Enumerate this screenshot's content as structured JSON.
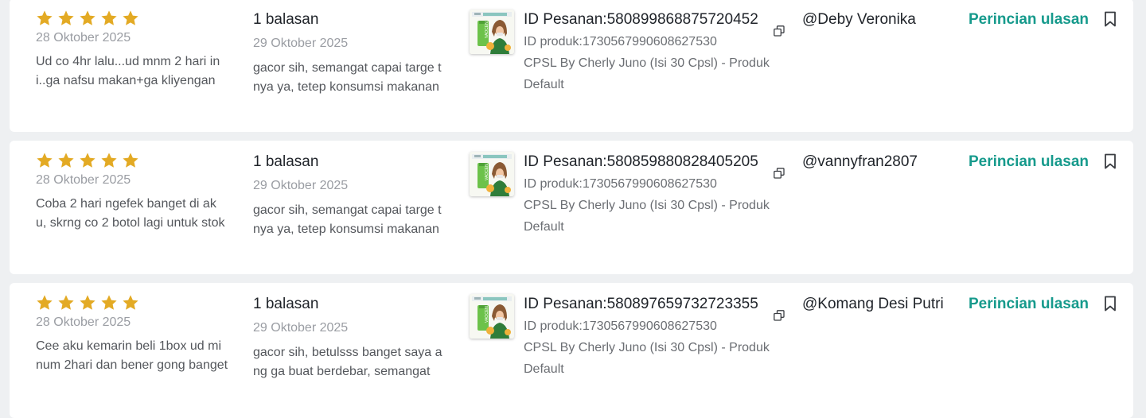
{
  "colors": {
    "star": "#e3aa24",
    "link": "#169a8c",
    "muted": "#9a9da3"
  },
  "icons": {
    "rating": "star-icon",
    "copy": "copy-icon",
    "save": "bookmark-icon"
  },
  "reviews": [
    {
      "rating": 5,
      "date": "28 Oktober 2025",
      "text": "Ud co 4hr lalu...ud mnm 2 hari in i..ga nafsu makan+ga kliyengan",
      "reply_count": "1 balasan",
      "reply_date": "29 Oktober 2025",
      "reply_text": "gacor sih, semangat capai targe tnya ya, tetep konsumsi makanan",
      "order_id": "ID Pesanan:580899868875720452",
      "product_id": "ID produk:1730567990608627530",
      "product_name": "CPSL By Cherly Juno (Isi 30 Cpsl) - Produk",
      "variant": "Default",
      "username": "@Deby Veronika",
      "detail_label": "Perincian ulasan"
    },
    {
      "rating": 5,
      "date": "28 Oktober 2025",
      "text": "Coba 2 hari ngefek banget di ak u, skrng co 2 botol lagi untuk stok",
      "reply_count": "1 balasan",
      "reply_date": "29 Oktober 2025",
      "reply_text": "gacor sih, semangat capai targe tnya ya, tetep konsumsi makanan",
      "order_id": "ID Pesanan:580859880828405205",
      "product_id": "ID produk:1730567990608627530",
      "product_name": "CPSL By Cherly Juno (Isi 30 Cpsl) - Produk",
      "variant": "Default",
      "username": "@vannyfran2807",
      "detail_label": "Perincian ulasan"
    },
    {
      "rating": 5,
      "date": "28 Oktober 2025",
      "text": "Cee aku kemarin beli 1box ud mi num 2hari dan bener gong banget",
      "reply_count": "1 balasan",
      "reply_date": "29 Oktober 2025",
      "reply_text": "gacor sih, betulsss banget saya ang ga buat berdebar, semangat",
      "order_id": "ID Pesanan:580897659732723355",
      "product_id": "ID produk:1730567990608627530",
      "product_name": "CPSL By Cherly Juno (Isi 30 Cpsl) - Produk",
      "variant": "Default",
      "username": "@Komang Desi Putri",
      "detail_label": "Perincian ulasan"
    }
  ]
}
